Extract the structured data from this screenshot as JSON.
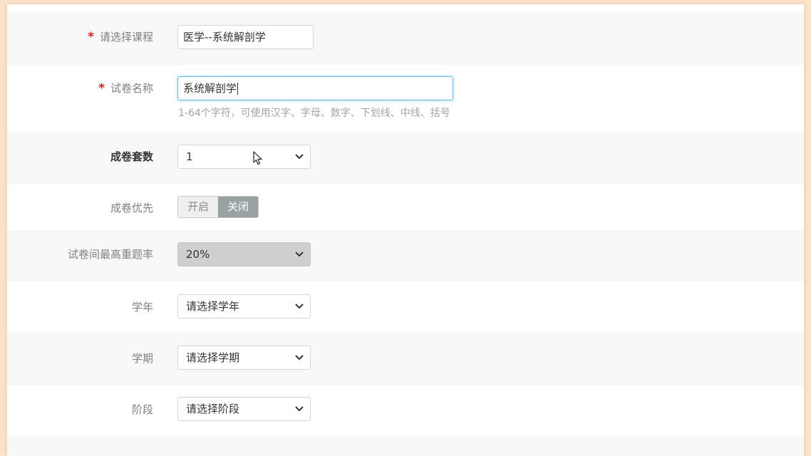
{
  "course": {
    "label": "请选择课程",
    "required_mark": "*",
    "value": "医学--系统解剖学"
  },
  "paper_name": {
    "label": "试卷名称",
    "required_mark": "*",
    "value": "系统解剖学",
    "hint": "1-64个字符，可使用汉字、字母、数字、下划线、中线、括号"
  },
  "paper_sets": {
    "label": "成卷套数",
    "value": "1"
  },
  "priority": {
    "label": "成卷优先",
    "on_label": "开启",
    "off_label": "关闭",
    "selected": "关闭"
  },
  "repeat_rate": {
    "label": "试卷间最高重题率",
    "value": "20%"
  },
  "school_year": {
    "label": "学年",
    "value": "请选择学年"
  },
  "semester": {
    "label": "学期",
    "value": "请选择学期"
  },
  "stage": {
    "label": "阶段",
    "value": "请选择阶段"
  },
  "colors": {
    "required": "#d0201c",
    "focus_border": "#63bcd9",
    "toggle_active": "#9aa1a2"
  }
}
